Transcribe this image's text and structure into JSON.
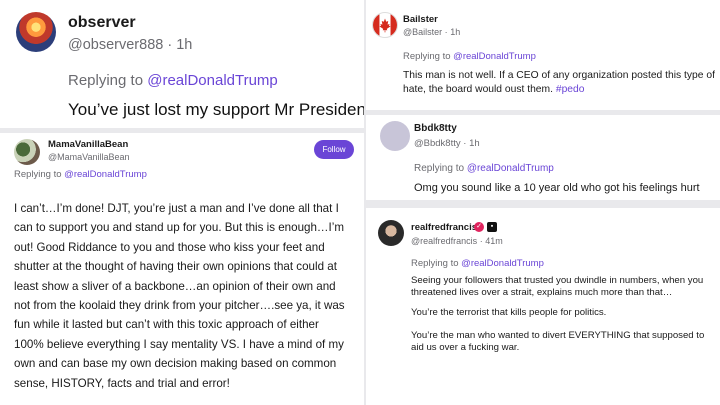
{
  "replies": {
    "observer": {
      "name": "observer",
      "handle": "@observer888",
      "time": "1h",
      "replying_prefix": "Replying to ",
      "replying_to": "@realDonaldTrump",
      "text": "You’ve just lost my support Mr President."
    },
    "mama": {
      "name": "MamaVanillaBean",
      "handle": "@MamaVanillaBean",
      "follow_label": "Follow",
      "replying_prefix": "Replying to ",
      "replying_to": "@realDonaldTrump",
      "text_lines": [
        "I can’t…I’m done! DJT, you’re just a man and I’ve done all that I",
        "can to support you and stand up for you. But this is enough…I’m",
        "out! Good Riddance to you and those who kiss your feet and",
        "shutter at the thought of having their own opinions that could at",
        "least show a sliver of a backbone…an opinion of their own and",
        "not from the koolaid they drink from your pitcher….see ya, it was",
        "fun while it lasted but can’t with this toxic approach of either",
        "100% believe everything I say mentality VS. I have a mind of my",
        "own and can base my own decision making based on common",
        "sense, HISTORY, facts and trial and error!"
      ]
    },
    "bailster": {
      "name": "Bailster",
      "handle": "@Bailster",
      "time": "1h",
      "replying_prefix": "Replying to ",
      "replying_to": "@realDonaldTrump",
      "text": "This man is not well. If a CEO of any organization posted this type of hate, the board would oust them. ",
      "hashtag": "#pedo"
    },
    "bbdk": {
      "name": "Bbdk8tty",
      "handle": "@Bbdk8tty",
      "time": "1h",
      "replying_prefix": "Replying to ",
      "replying_to": "@realDonaldTrump",
      "text": "Omg you sound like a 10 year old who got his feelings hurt"
    },
    "fred": {
      "name": "realfredfrancis",
      "handle": "@realfredfrancis",
      "time": "41m",
      "replying_prefix": "Replying to ",
      "replying_to": "@realDonaldTrump",
      "paragraphs": [
        "Seeing your followers that trusted you dwindle in numbers, when you threatened lives over a strait, explains much more than that…",
        "You’re the terrorist that kills people for politics.",
        "You’re the man who wanted to divert EVERYTHING that supposed to aid us over a fucking war."
      ]
    }
  },
  "separator": "·",
  "colors": {
    "accent": "#6a45d6",
    "muted": "#6b6b70"
  }
}
